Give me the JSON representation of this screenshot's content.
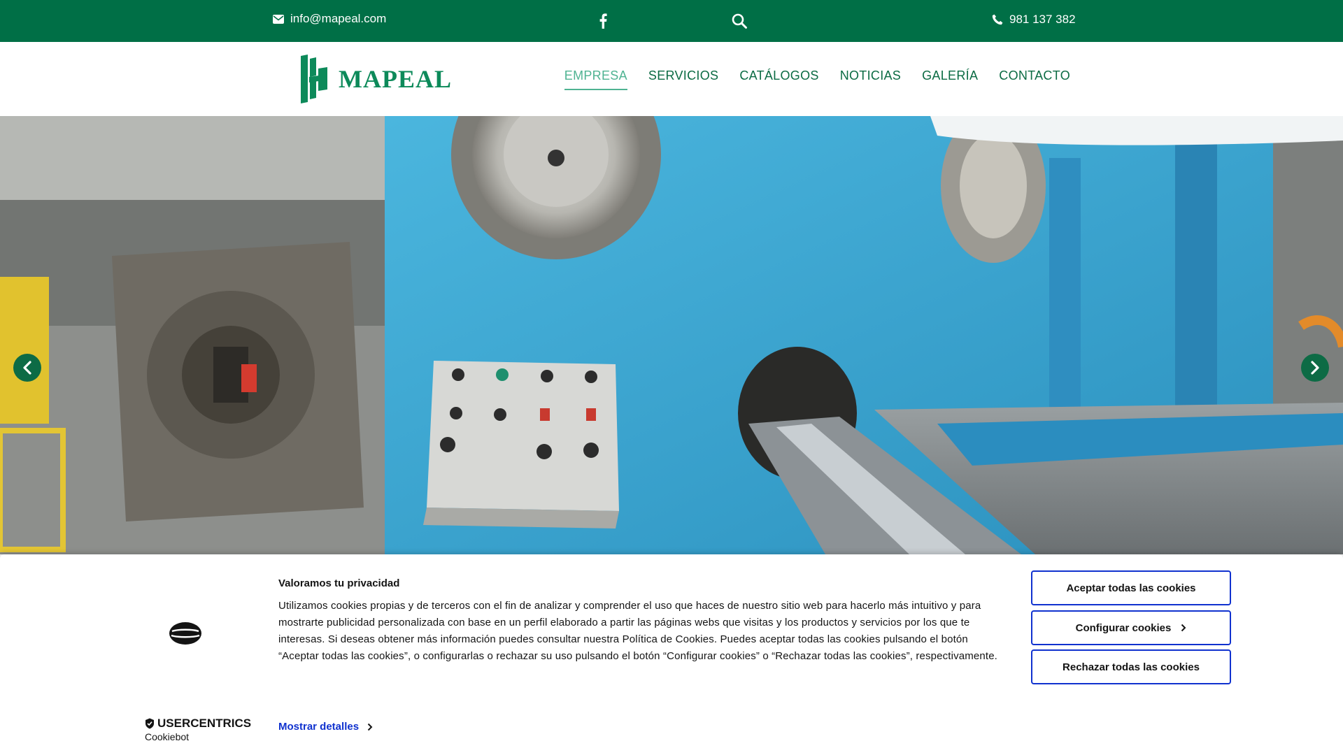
{
  "topbar": {
    "email": "info@mapeal.com",
    "phone": "981 137 382",
    "icons": [
      "envelope-icon",
      "facebook-icon",
      "search-icon",
      "phone-icon"
    ]
  },
  "header": {
    "logo_text": "MAPEAL",
    "nav": [
      {
        "label": "EMPRESA",
        "active": true
      },
      {
        "label": "SERVICIOS",
        "active": false
      },
      {
        "label": "CATÁLOGOS",
        "active": false
      },
      {
        "label": "NOTICIAS",
        "active": false
      },
      {
        "label": "GALERÍA",
        "active": false
      },
      {
        "label": "CONTACTO",
        "active": false
      }
    ]
  },
  "hero": {
    "icons": [
      "chevron-left-icon",
      "chevron-right-icon"
    ]
  },
  "cookie": {
    "title": "Valoramos tu privacidad",
    "text": "Utilizamos cookies propias y de terceros con el fin de analizar y comprender el uso que haces de nuestro sitio web para hacerlo más intuitivo y para mostrarte publicidad personalizada con base en un perfil elaborado a partir las páginas webs que visitas y los productos y servicios por los que te interesas. Si deseas obtener más información puedes consultar nuestra Política de Cookies. Puedes aceptar todas las cookies pulsando el botón “Aceptar todas las cookies”, o configurarlas o rechazar su uso pulsando el botón “Configurar cookies” o “Rechazar todas las cookies”, respectivamente.",
    "details_link": "Mostrar detalles",
    "accept_label": "Aceptar todas las cookies",
    "configure_label": "Configurar cookies",
    "reject_label": "Rechazar todas las cookies",
    "brand_name": "USERCENTRICS",
    "brand_sub": "Cookiebot"
  },
  "colors": {
    "brand_green": "#006f46",
    "nav_active": "#4fb392",
    "cookie_button_border": "#1032cf"
  }
}
